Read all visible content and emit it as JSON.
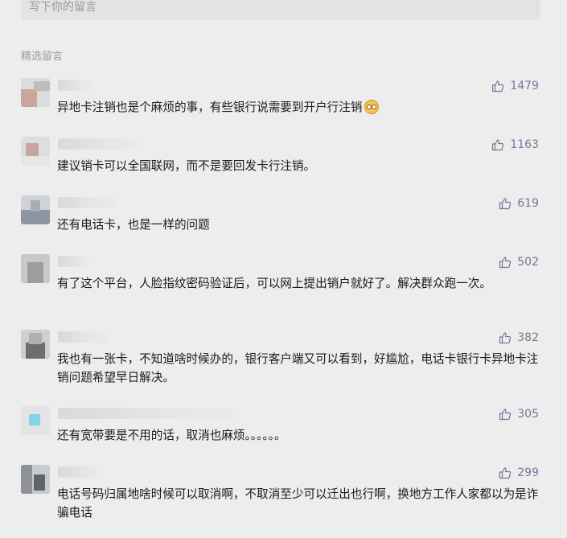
{
  "input": {
    "placeholder": "写下你的留言"
  },
  "section_title": "精选留言",
  "colors": {
    "background": "#ededed",
    "like_color": "#6f7a98",
    "secondary_text": "#9a9a9a"
  },
  "comments": [
    {
      "likes": "1479",
      "text": "异地卡注销也是个麻烦的事，有些银行说需要到开户行注销",
      "emoji": "flushed-face-emoji"
    },
    {
      "likes": "1163",
      "text": "建议销卡可以全国联网，而不是要回发卡行注销。"
    },
    {
      "likes": "619",
      "text": "还有电话卡，也是一样的问题"
    },
    {
      "likes": "502",
      "text": "有了这个平台，人脸指纹密码验证后，可以网上提出销户就好了。解决群众跑一次。"
    },
    {
      "likes": "382",
      "text": "我也有一张卡，不知道啥时候办的，银行客户端又可以看到，好尴尬，电话卡银行卡异地卡注销问题希望早日解决。"
    },
    {
      "likes": "305",
      "text": "还有宽带要是不用的话，取消也麻烦。。。。。。"
    },
    {
      "likes": "299",
      "text": "电话号码归属地啥时候可以取消啊，不取消至少可以迁出也行啊，换地方工作人家都以为是诈骗电话"
    }
  ]
}
